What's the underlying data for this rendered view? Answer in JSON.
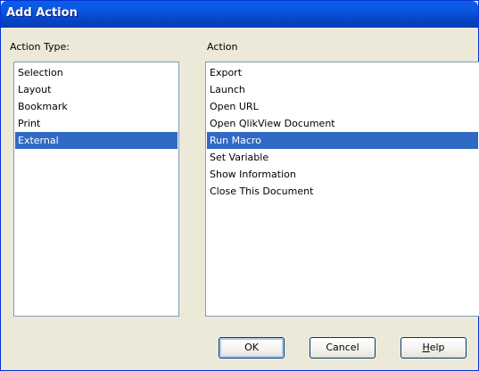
{
  "window": {
    "title": "Add Action"
  },
  "action_type": {
    "label": "Action Type:",
    "items": [
      "Selection",
      "Layout",
      "Bookmark",
      "Print",
      "External"
    ],
    "selected": "External"
  },
  "action": {
    "label": "Action",
    "items": [
      "Export",
      "Launch",
      "Open URL",
      "Open QlikView Document",
      "Run Macro",
      "Set Variable",
      "Show Information",
      "Close This Document"
    ],
    "selected": "Run Macro"
  },
  "buttons": {
    "ok": "OK",
    "cancel": "Cancel",
    "help_mnemonic": "H",
    "help_rest": "elp"
  },
  "colors": {
    "title_bar": "#0a5ee8",
    "dialog_bg": "#ece9d8",
    "selection": "#316ac5",
    "listbox_border": "#7f9db9"
  }
}
